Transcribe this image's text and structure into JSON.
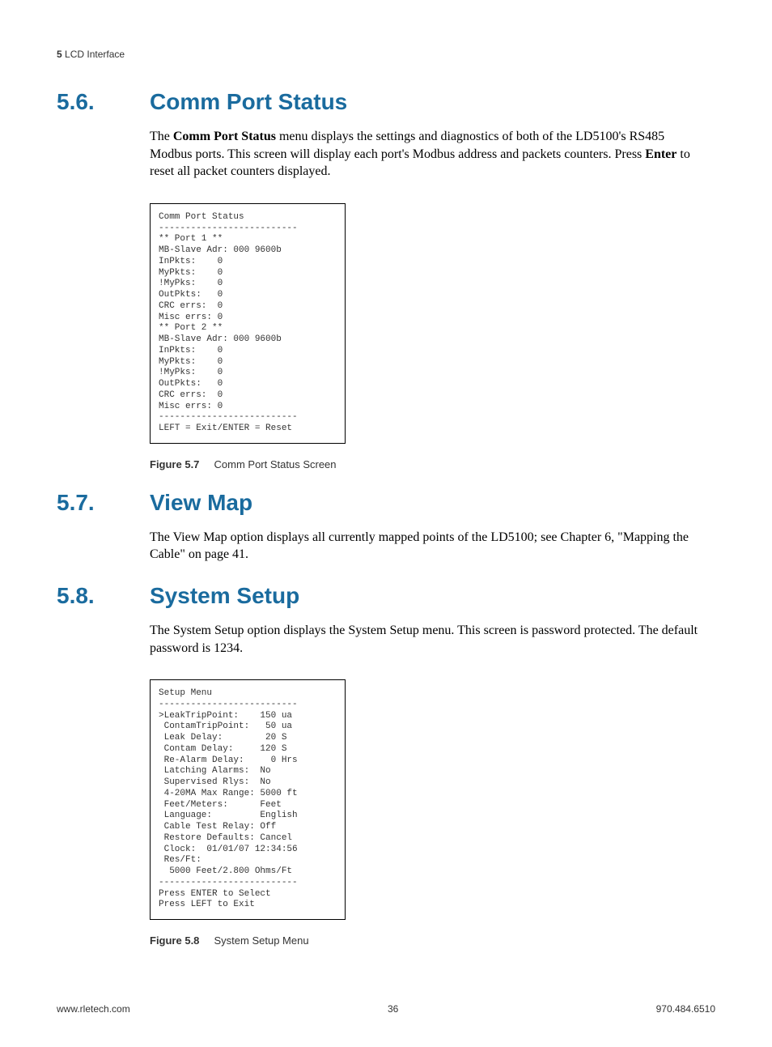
{
  "header": {
    "chapter_num": "5",
    "chapter_title": "LCD Interface"
  },
  "sections": {
    "s56": {
      "num": "5.6.",
      "title": "Comm Port Status",
      "para_1a": "The ",
      "para_1_bold1": "Comm Port Status",
      "para_1b": " menu displays the settings and diagnostics of both of the LD5100's RS485 Modbus ports. This screen will display each port's Modbus address and packets counters. Press ",
      "para_1_bold2": "Enter",
      "para_1c": " to reset all packet counters displayed."
    },
    "s57": {
      "num": "5.7.",
      "title": "View Map",
      "para": "The View Map option displays all currently mapped points of the LD5100; see Chapter 6, \"Mapping the Cable\" on page 41."
    },
    "s58": {
      "num": "5.8.",
      "title": "System Setup",
      "para": "The System Setup option displays the System Setup menu. This screen is password protected. The default password is 1234."
    }
  },
  "figures": {
    "f57": {
      "label": "Figure 5.7",
      "caption": "Comm Port Status Screen",
      "lcd": "Comm Port Status\n--------------------------\n** Port 1 **\nMB-Slave Adr: 000 9600b\nInPkts:    0\nMyPkts:    0\n!MyPks:    0\nOutPkts:   0\nCRC errs:  0\nMisc errs: 0\n** Port 2 **\nMB-Slave Adr: 000 9600b\nInPkts:    0\nMyPkts:    0\n!MyPks:    0\nOutPkts:   0\nCRC errs:  0\nMisc errs: 0\n--------------------------\nLEFT = Exit/ENTER = Reset"
    },
    "f58": {
      "label": "Figure 5.8",
      "caption": "System Setup Menu",
      "lcd": "Setup Menu\n--------------------------\n>LeakTripPoint:    150 ua\n ContamTripPoint:   50 ua\n Leak Delay:        20 S\n Contam Delay:     120 S\n Re-Alarm Delay:     0 Hrs\n Latching Alarms:  No\n Supervised Rlys:  No\n 4-20MA Max Range: 5000 ft\n Feet/Meters:      Feet\n Language:         English\n Cable Test Relay: Off\n Restore Defaults: Cancel\n Clock:  01/01/07 12:34:56\n Res/Ft:\n  5000 Feet/2.800 Ohms/Ft\n--------------------------\nPress ENTER to Select\nPress LEFT to Exit"
    }
  },
  "footer": {
    "left": "www.rletech.com",
    "center": "36",
    "right": "970.484.6510"
  }
}
